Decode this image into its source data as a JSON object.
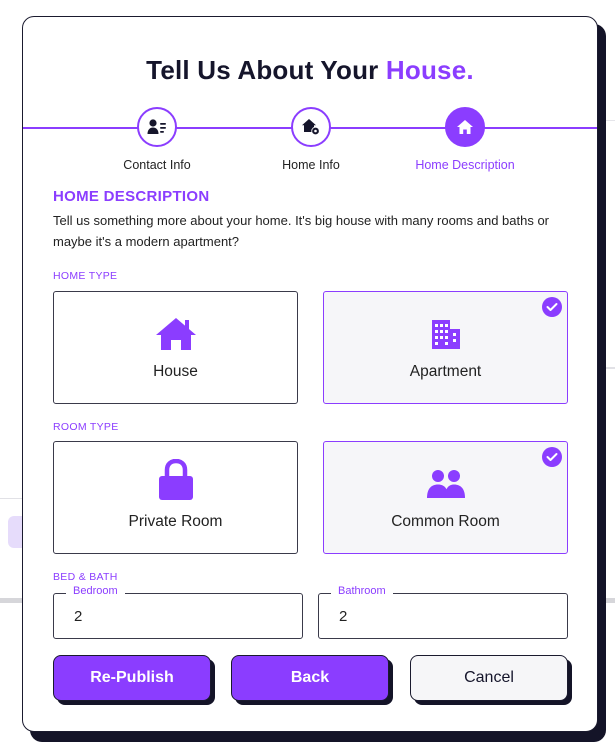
{
  "modal": {
    "title_main": "Tell Us About Your",
    "title_accent": "House."
  },
  "stepper": {
    "steps": [
      {
        "label": "Contact Info",
        "icon": "contact-list-icon",
        "state": "done"
      },
      {
        "label": "Home Info",
        "icon": "home-settings-icon",
        "state": "done"
      },
      {
        "label": "Home Description",
        "icon": "home-icon",
        "state": "active"
      }
    ]
  },
  "section": {
    "title": "HOME DESCRIPTION",
    "description": "Tell us something more about your home. It's big house with many rooms and baths or maybe it's a modern apartment?"
  },
  "home_type": {
    "label": "HOME TYPE",
    "options": [
      {
        "label": "House",
        "icon": "house-icon",
        "selected": false
      },
      {
        "label": "Apartment",
        "icon": "building-icon",
        "selected": true
      }
    ]
  },
  "room_type": {
    "label": "ROOM TYPE",
    "options": [
      {
        "label": "Private Room",
        "icon": "lock-icon",
        "selected": false
      },
      {
        "label": "Common Room",
        "icon": "people-icon",
        "selected": true
      }
    ]
  },
  "bed_bath": {
    "label": "BED & BATH",
    "bedroom": {
      "label": "Bedroom",
      "value": "2"
    },
    "bathroom": {
      "label": "Bathroom",
      "value": "2"
    }
  },
  "actions": {
    "republish": "Re-Publish",
    "back": "Back",
    "cancel": "Cancel"
  },
  "colors": {
    "accent": "#8b3dff",
    "text_dark": "#15152b",
    "shadow": "#141428"
  }
}
